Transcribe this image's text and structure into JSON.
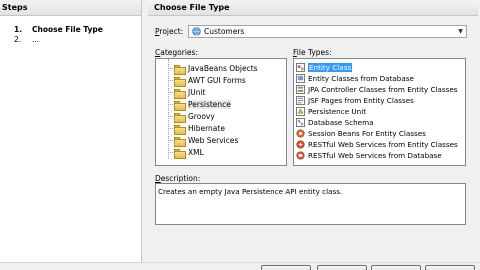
{
  "steps": {
    "title": "Steps",
    "items": [
      {
        "num": "1.",
        "label": "Choose File Type"
      },
      {
        "num": "2.",
        "label": "..."
      }
    ]
  },
  "main": {
    "title": "Choose File Type",
    "project_label": "Project:",
    "project_value": "Customers",
    "categories_label": "Categories:",
    "filetypes_label": "File Types:",
    "description_label": "Description:",
    "description_text": "Creates an empty Java Persistence API entity class."
  },
  "categories": [
    {
      "label": "JavaBeans Objects"
    },
    {
      "label": "AWT GUI Forms"
    },
    {
      "label": "JUnit"
    },
    {
      "label": "Persistence",
      "selected": true
    },
    {
      "label": "Groovy"
    },
    {
      "label": "Hibernate"
    },
    {
      "label": "Web Services"
    },
    {
      "label": "XML"
    }
  ],
  "file_types": [
    {
      "label": "Entity Class",
      "icon": "entity-class-icon",
      "selected": true
    },
    {
      "label": "Entity Classes from Database",
      "icon": "entity-db-icon"
    },
    {
      "label": "JPA Controller Classes from Entity Classes",
      "icon": "jpa-controller-icon"
    },
    {
      "label": "JSF Pages from Entity Classes",
      "icon": "jsf-pages-icon"
    },
    {
      "label": "Persistence Unit",
      "icon": "persistence-unit-icon"
    },
    {
      "label": "Database Schema",
      "icon": "database-schema-icon"
    },
    {
      "label": "Session Beans For Entity Classes",
      "icon": "session-beans-icon"
    },
    {
      "label": "RESTful Web Services from Entity Classes",
      "icon": "restful-entity-icon"
    },
    {
      "label": "RESTful Web Services from Database",
      "icon": "restful-db-icon"
    }
  ],
  "colors": {
    "selection": "#3399ff",
    "folder": "#e8bf4a",
    "header_bg": "#e6e6e6"
  }
}
